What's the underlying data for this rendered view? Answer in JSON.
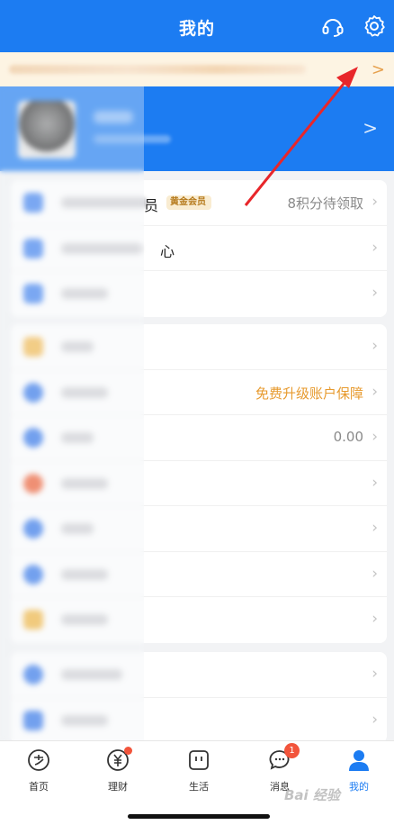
{
  "header": {
    "title": "我的"
  },
  "icons": {
    "support": "headset-icon",
    "settings": "gear-icon",
    "chevron": "chevron-right-icon"
  },
  "colors": {
    "brand": "#1c7cf2",
    "notice_bg": "#fdf4e3",
    "accent_orange": "#e79a2e",
    "badge_red": "#f2543b",
    "arrow_red": "#e8262a"
  },
  "notice": {
    "chevron": ">"
  },
  "profile": {
    "chevron": ">"
  },
  "card1": {
    "rows": [
      {
        "label_visible": "员",
        "badge": "黄金会员",
        "value": "8积分待领取"
      },
      {
        "label_visible": "心",
        "value": ""
      },
      {
        "label_visible": "",
        "value": ""
      }
    ]
  },
  "card2": {
    "rows": [
      {
        "value": ""
      },
      {
        "value": "免费升级账户保障"
      },
      {
        "value": "0.00"
      },
      {
        "value": ""
      },
      {
        "value": ""
      },
      {
        "value": ""
      },
      {
        "value": ""
      }
    ]
  },
  "card3": {
    "rows": [
      {
        "value": ""
      },
      {
        "value": ""
      }
    ]
  },
  "tabbar": {
    "tabs": [
      {
        "label": "首页",
        "icon": "alipay-home-icon"
      },
      {
        "label": "理财",
        "icon": "wealth-yuan-icon",
        "dot": true
      },
      {
        "label": "生活",
        "icon": "life-bag-icon"
      },
      {
        "label": "消息",
        "icon": "message-bubble-icon",
        "badge": "1"
      },
      {
        "label": "我的",
        "icon": "profile-person-icon",
        "active": true
      }
    ]
  },
  "watermark": "Bai 经验"
}
